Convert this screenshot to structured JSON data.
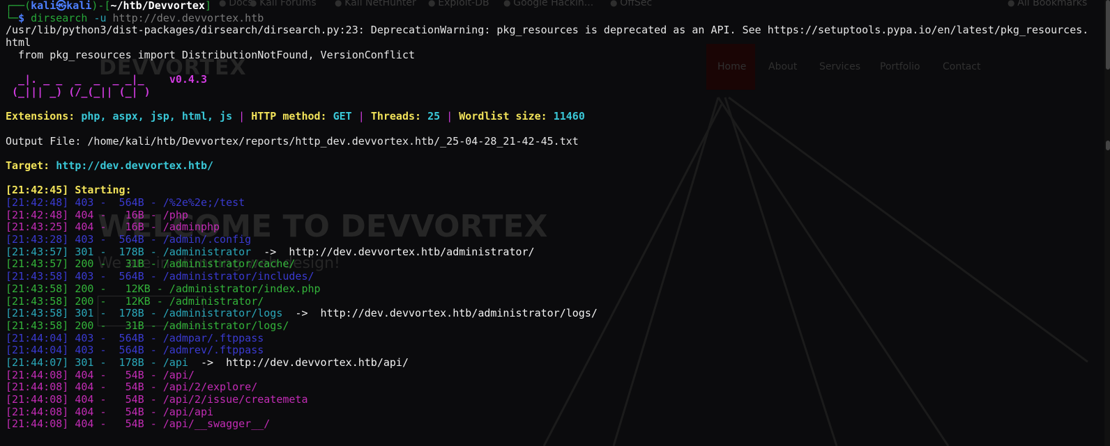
{
  "background": {
    "bookmarks": [
      "Docs",
      "Kali Forums",
      "Kali NetHunter",
      "Exploit-DB",
      "Google Hackin...",
      "OffSec",
      "All Bookmarks"
    ],
    "site_logo": "DEVVORTEX",
    "nav": [
      "Home",
      "About",
      "Services",
      "Portfolio",
      "Contact"
    ],
    "hero_title": "WELCOME TO DEVVORTEX",
    "hero_subtitle": "We are in stunning web design!"
  },
  "prompt": {
    "user": "kali",
    "host_sep": "㉿",
    "host": "kali",
    "path": "~/htb/Devvortex",
    "symbol": "$",
    "cmd": "dirsearch",
    "flag": "-u",
    "arg": "http://dev.devvortex.htb"
  },
  "warning": {
    "line1": "/usr/lib/python3/dist-packages/dirsearch/dirsearch.py:23: DeprecationWarning: pkg_resources is deprecated as an API. See https://setuptools.pypa.io/en/latest/pkg_resources.html",
    "line2": "  from pkg_resources import DistributionNotFound, VersionConflict"
  },
  "banner": {
    "art1": "  _|. _ _  _  _  _ _|_    ",
    "art2": " (_||| _) (/_(_|| (_| )",
    "version": "v0.4.3"
  },
  "config": {
    "ext_label": "Extensions:",
    "ext_value": "php, aspx, jsp, html, js",
    "sep": "|",
    "method_label": "HTTP method:",
    "method_value": "GET",
    "threads_label": "Threads:",
    "threads_value": "25",
    "wordlist_label": "Wordlist size:",
    "wordlist_value": "11460"
  },
  "output_file": "Output File: /home/kali/htb/Devvortex/reports/http_dev.devvortex.htb/_25-04-28_21-42-45.txt",
  "target": {
    "label": "Target:",
    "url": "http://dev.devvortex.htb/"
  },
  "starting": "[21:42:45] Starting:",
  "results": [
    {
      "time": "[21:42:48]",
      "status": "403",
      "size": " 564B",
      "path": "/%2e%2e;/test",
      "redirect": ""
    },
    {
      "time": "[21:42:48]",
      "status": "404",
      "size": "  16B",
      "path": "/php",
      "redirect": ""
    },
    {
      "time": "[21:43:25]",
      "status": "404",
      "size": "  16B",
      "path": "/adminphp",
      "redirect": ""
    },
    {
      "time": "[21:43:28]",
      "status": "403",
      "size": " 564B",
      "path": "/admin/.config",
      "redirect": ""
    },
    {
      "time": "[21:43:57]",
      "status": "301",
      "size": " 178B",
      "path": "/administrator",
      "redirect": "http://dev.devvortex.htb/administrator/"
    },
    {
      "time": "[21:43:57]",
      "status": "200",
      "size": "  31B",
      "path": "/administrator/cache/",
      "redirect": ""
    },
    {
      "time": "[21:43:58]",
      "status": "403",
      "size": " 564B",
      "path": "/administrator/includes/",
      "redirect": ""
    },
    {
      "time": "[21:43:58]",
      "status": "200",
      "size": "  12KB",
      "path": "/administrator/index.php",
      "redirect": ""
    },
    {
      "time": "[21:43:58]",
      "status": "200",
      "size": "  12KB",
      "path": "/administrator/",
      "redirect": ""
    },
    {
      "time": "[21:43:58]",
      "status": "301",
      "size": " 178B",
      "path": "/administrator/logs",
      "redirect": "http://dev.devvortex.htb/administrator/logs/"
    },
    {
      "time": "[21:43:58]",
      "status": "200",
      "size": "  31B",
      "path": "/administrator/logs/",
      "redirect": ""
    },
    {
      "time": "[21:44:04]",
      "status": "403",
      "size": " 564B",
      "path": "/admpar/.ftppass",
      "redirect": ""
    },
    {
      "time": "[21:44:04]",
      "status": "403",
      "size": " 564B",
      "path": "/admrev/.ftppass",
      "redirect": ""
    },
    {
      "time": "[21:44:07]",
      "status": "301",
      "size": " 178B",
      "path": "/api",
      "redirect": "http://dev.devvortex.htb/api/"
    },
    {
      "time": "[21:44:08]",
      "status": "404",
      "size": "  54B",
      "path": "/api/",
      "redirect": ""
    },
    {
      "time": "[21:44:08]",
      "status": "404",
      "size": "  54B",
      "path": "/api/2/explore/",
      "redirect": ""
    },
    {
      "time": "[21:44:08]",
      "status": "404",
      "size": "  54B",
      "path": "/api/2/issue/createmeta",
      "redirect": ""
    },
    {
      "time": "[21:44:08]",
      "status": "404",
      "size": "  54B",
      "path": "/api/api",
      "redirect": ""
    },
    {
      "time": "[21:44:08]",
      "status": "404",
      "size": "  54B",
      "path": "/api/__swagger__/",
      "redirect": ""
    }
  ]
}
